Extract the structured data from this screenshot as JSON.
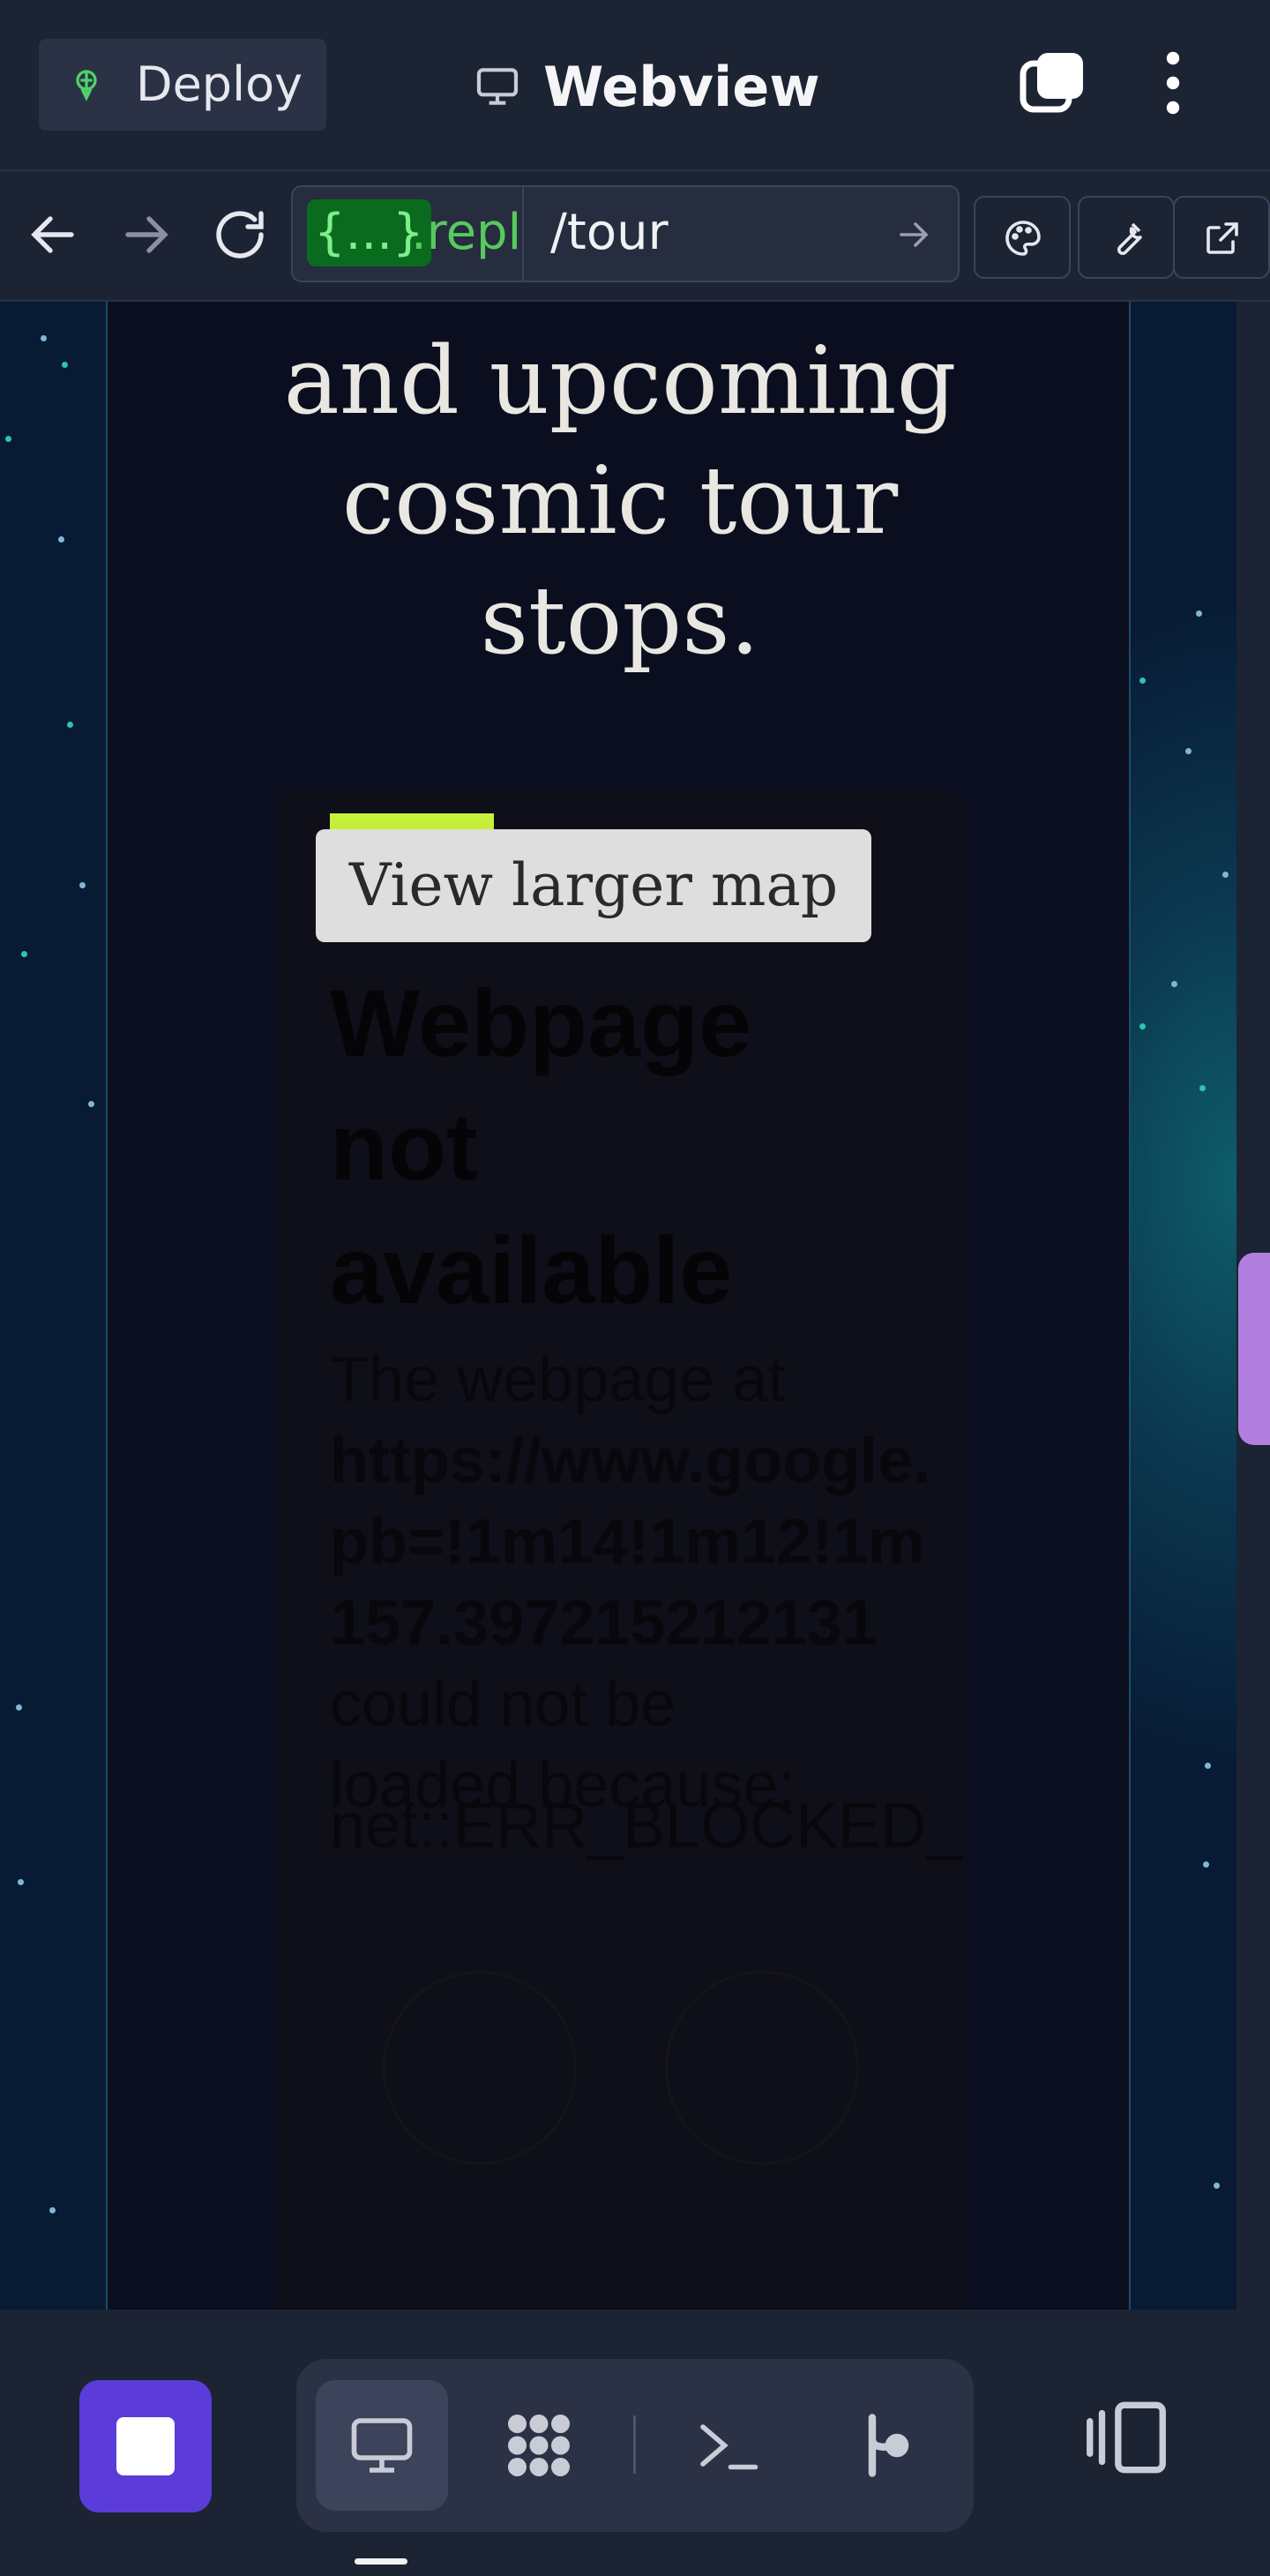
{
  "header": {
    "deploy_label": "Deploy",
    "title": "Webview"
  },
  "nav": {
    "url_brace": "{...}",
    "url_host": ".repl",
    "url_path": "/tour"
  },
  "page": {
    "tagline_lines": [
      "and upcoming",
      "cosmic tour",
      "stops."
    ],
    "map": {
      "view_larger_label": "View larger map",
      "error_title_lines": [
        "Webpage",
        "not",
        "available"
      ],
      "error_intro": "The webpage at",
      "error_url_lines": [
        "https://www.google.",
        "pb=!1m14!1m12!1m",
        "157.397215212131"
      ],
      "error_outro_lines": [
        "could not be",
        "loaded because:"
      ],
      "error_code": "net::ERR_BLOCKED_"
    }
  },
  "icons": {
    "deploy": "deploy-icon",
    "monitor": "monitor-icon",
    "tabs": "tabs-icon",
    "more": "kebab-icon",
    "back": "back-arrow-icon",
    "forward": "forward-arrow-icon",
    "reload": "reload-icon",
    "go": "go-arrow-icon",
    "theme": "palette-icon",
    "devtools": "wrench-icon",
    "open_external": "external-link-icon",
    "stop": "stop-icon",
    "webview_tool": "monitor-icon",
    "apps_tool": "grid-icon",
    "shell_tool": "terminal-icon",
    "git_tool": "git-icon",
    "panel": "panel-icon"
  },
  "colors": {
    "bg": "#1c2333",
    "accent_stop": "#5b3cd9",
    "url_green": "#58c95f",
    "scroll_thumb": "#b07fe0"
  }
}
